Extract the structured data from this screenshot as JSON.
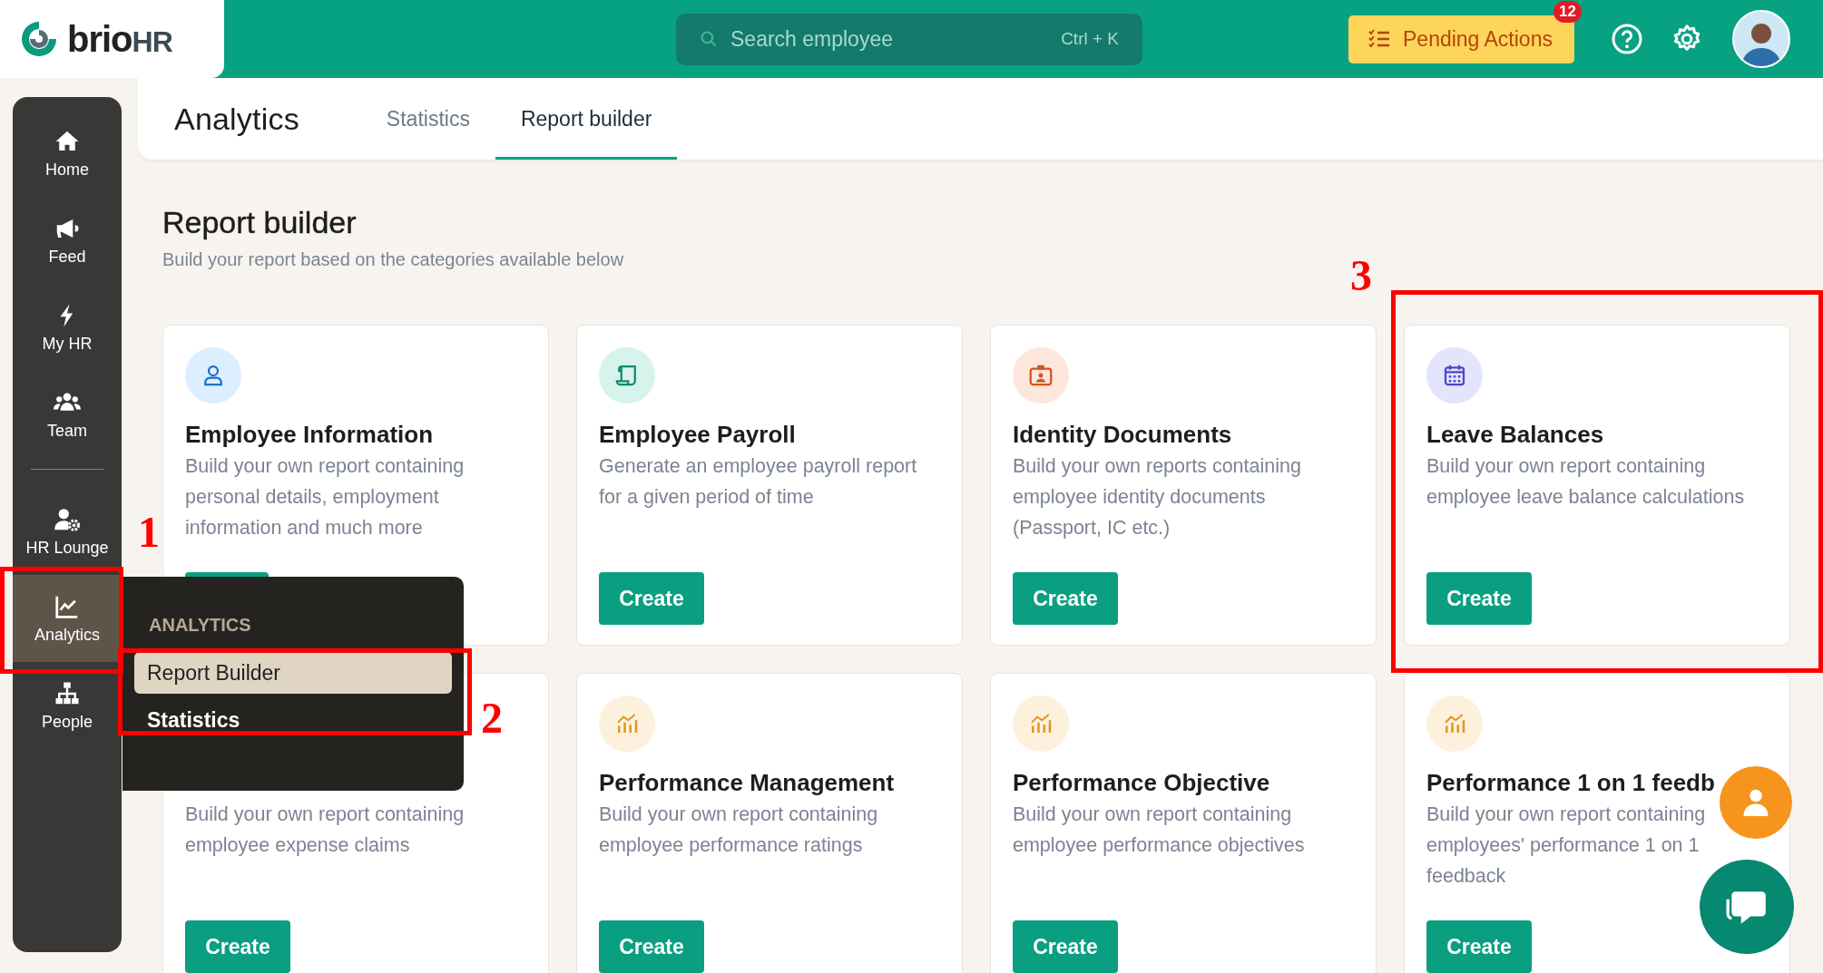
{
  "topbar": {
    "brand": "brio",
    "brand_suffix": "HR",
    "search": {
      "placeholder": "Search employee",
      "shortcut": "Ctrl + K"
    },
    "pending": {
      "label": "Pending Actions",
      "count": "12"
    }
  },
  "sidebar": {
    "sections": [
      {
        "items": [
          {
            "label": "Home",
            "selected": false
          },
          {
            "label": "Feed",
            "selected": false
          },
          {
            "label": "My HR",
            "selected": false
          },
          {
            "label": "Team",
            "selected": false
          }
        ]
      },
      {
        "items": [
          {
            "label": "HR Lounge",
            "selected": false
          },
          {
            "label": "Analytics",
            "selected": true
          },
          {
            "label": "People",
            "selected": false
          }
        ]
      }
    ]
  },
  "header": {
    "title": "Analytics",
    "tabs": [
      {
        "label": "Statistics",
        "selected": false
      },
      {
        "label": "Report builder",
        "selected": true
      }
    ]
  },
  "page": {
    "title": "Report builder",
    "subtitle": "Build your report based on the categories available below"
  },
  "cards": [
    {
      "title": "Employee Information",
      "description": "Build your own report containing personal details, employment information and much more"
    },
    {
      "title": "Employee Payroll",
      "description": "Generate an employee payroll report for a given period of time",
      "button": "Create"
    },
    {
      "title": "Identity Documents",
      "description": "Build your own reports containing employee identity documents (Passport, IC etc.)",
      "button": "Create"
    },
    {
      "title": "Leave Balances",
      "description": "Build your own report containing employee leave balance calculations",
      "button": "Create"
    },
    {
      "description": "Build your own report containing employee expense claims",
      "button": "Create"
    },
    {
      "title": "Performance Management",
      "description": "Build your own report containing employee performance ratings",
      "button": "Create"
    },
    {
      "title": "Performance Objective",
      "description": "Build your own report containing employee performance objectives",
      "button": "Create"
    },
    {
      "title": "Performance 1 on 1 feedb",
      "description": "Build your own report containing employees' performance 1 on 1 feedback",
      "button": "Create"
    }
  ],
  "flyout": {
    "heading": "ANALYTICS",
    "items": [
      {
        "label": "Report Builder",
        "selected": true
      },
      {
        "label": "Statistics",
        "selected": false
      }
    ]
  },
  "annotations": [
    {
      "label": "1"
    },
    {
      "label": "2"
    },
    {
      "label": "3"
    }
  ]
}
